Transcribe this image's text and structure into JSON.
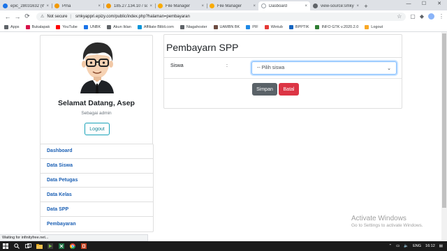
{
  "browser": {
    "tabs": [
      {
        "label": "epic_28031632 (WI",
        "color": "#1a73e8",
        "active": false
      },
      {
        "label": "Pma",
        "color": "#f29900",
        "active": false
      },
      {
        "label": "185.27.134.10 / sq",
        "color": "#f29900",
        "active": false
      },
      {
        "label": "File Manager",
        "color": "#f9ab00",
        "active": false
      },
      {
        "label": "File Manager",
        "color": "#f9ab00",
        "active": false
      },
      {
        "label": "Dasboard",
        "color": "#ffffff",
        "active": true
      },
      {
        "label": "view-source:smkyc",
        "color": "#5f6368",
        "active": false
      }
    ],
    "close_glyph": "×",
    "new_tab_glyph": "+",
    "address": {
      "security_label": "Not secure",
      "url": "smkyappri.epizy.com/public/index.php?halaman=pembayaran"
    },
    "bookmarks": [
      {
        "label": "Apps",
        "color": "#5f6368"
      },
      {
        "label": "Bukalapak",
        "color": "#d71149"
      },
      {
        "label": "YouTube",
        "color": "#ff0000"
      },
      {
        "label": "UNBK",
        "color": "#1a73e8"
      },
      {
        "label": "Akun Iklan",
        "color": "#5f6368"
      },
      {
        "label": "Affiliate Blibli.com",
        "color": "#0095da"
      },
      {
        "label": "Niagahoster",
        "color": "#5f6368"
      },
      {
        "label": "UAMBN BK",
        "color": "#6d4c41"
      },
      {
        "label": "PIF",
        "color": "#1e88e5"
      },
      {
        "label": "Wintub",
        "color": "#e53935"
      },
      {
        "label": "BPPTIK",
        "color": "#1565c0"
      },
      {
        "label": "INFO GTK v.2020.2.0",
        "color": "#2e7d32"
      },
      {
        "label": "Logout",
        "color": "#f9a825"
      }
    ],
    "status_text": "Waiting for infinityfree.net..."
  },
  "sidebar": {
    "welcome": "Selamat Datang, Asep",
    "role": "Sebagai admin",
    "logout_label": "Logout",
    "menu": [
      {
        "label": "Dashboard"
      },
      {
        "label": "Data Siswa"
      },
      {
        "label": "Data Petugas"
      },
      {
        "label": "Data Kelas"
      },
      {
        "label": "Data SPP"
      },
      {
        "label": "Pembayaran"
      }
    ]
  },
  "main": {
    "title": "Pembayarn SPP",
    "form": {
      "siswa_label": "Siswa",
      "colon": ":",
      "siswa_select_value": "-- Pilih siswa",
      "save_label": "Simpan",
      "cancel_label": "Batal"
    }
  },
  "watermark": {
    "line1": "Activate Windows",
    "line2": "Go to Settings to activate Windows."
  },
  "taskbar": {
    "language": "ENG",
    "time": "16:12"
  },
  "colors": {
    "menu_link": "#1a5fb4",
    "save_button": "#5a6268",
    "cancel_button": "#dc3545",
    "logout_outline": "#17a2b8"
  }
}
